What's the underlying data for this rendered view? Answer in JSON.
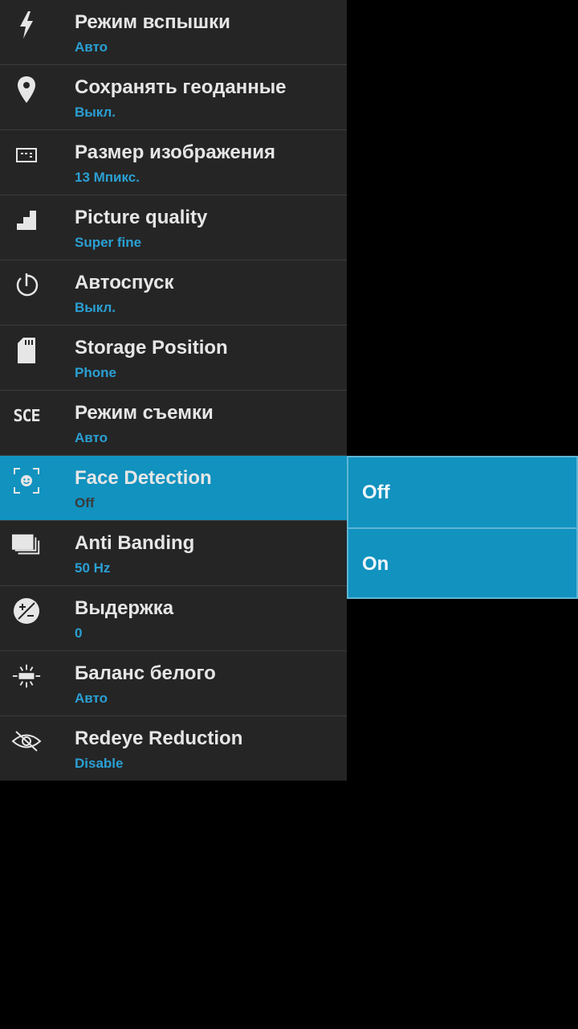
{
  "settings": [
    {
      "title": "Режим вспышки",
      "value": "Авто",
      "icon": "flash-icon"
    },
    {
      "title": "Сохранять геоданные",
      "value": "Выкл.",
      "icon": "location-pin-icon"
    },
    {
      "title": "Размер изображения",
      "value": "13 Мпикс.",
      "icon": "image-size-icon"
    },
    {
      "title": "Picture quality",
      "value": "Super fine",
      "icon": "quality-steps-icon"
    },
    {
      "title": "Автоспуск",
      "value": "Выкл.",
      "icon": "timer-icon"
    },
    {
      "title": "Storage Position",
      "value": "Phone",
      "icon": "sd-card-icon"
    },
    {
      "title": "Режим съемки",
      "value": "Авто",
      "icon": "scene-mode-icon",
      "icon_text": "SCE"
    },
    {
      "title": "Face Detection",
      "value": "Off",
      "icon": "face-detection-icon"
    },
    {
      "title": "Anti Banding",
      "value": "50 Hz",
      "icon": "anti-banding-icon"
    },
    {
      "title": "Выдержка",
      "value": "0",
      "icon": "exposure-icon"
    },
    {
      "title": "Баланс белого",
      "value": "Авто",
      "icon": "white-balance-icon"
    },
    {
      "title": "Redeye Reduction",
      "value": "Disable",
      "icon": "redeye-icon"
    }
  ],
  "selected_index": 7,
  "popup": {
    "options": [
      "Off",
      "On"
    ]
  },
  "colors": {
    "list_bg": "#252525",
    "accent": "#1192bf",
    "value_text": "#2aa0d4",
    "title_text": "#e6e6e6"
  }
}
